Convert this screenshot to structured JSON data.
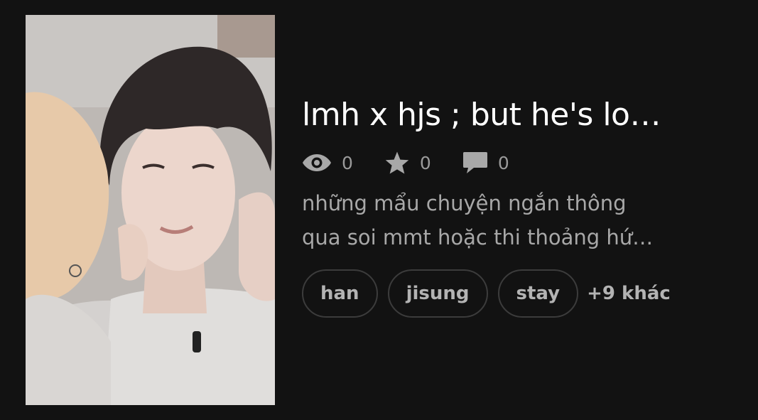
{
  "story": {
    "title": "lmh x hjs ; but he's lo…",
    "stats": [
      {
        "icon": "eye-icon",
        "value": "0"
      },
      {
        "icon": "star-icon",
        "value": "0"
      },
      {
        "icon": "comment-icon",
        "value": "0"
      }
    ],
    "description_lines": [
      "những mẩu chuyện ngắn thông",
      "qua soi mmt hoặc thi thoảng hứ…"
    ],
    "tags": [
      "han",
      "jisung",
      "stay"
    ],
    "more_tags": "+9 khác"
  },
  "colors": {
    "background": "#121212",
    "title": "#ffffff",
    "muted_text": "#a8a8a8",
    "tag_border": "#3c3c3c"
  }
}
